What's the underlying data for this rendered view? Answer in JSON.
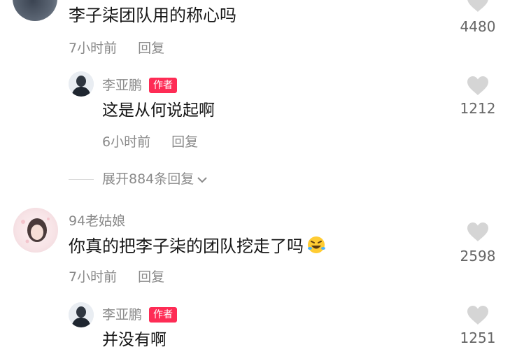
{
  "comments": [
    {
      "text": "李子柒团队用的称心吗",
      "time": "7小时前",
      "reply_label": "回复",
      "likes": "4480",
      "replies": [
        {
          "username": "李亚鹏",
          "badge": "作者",
          "text": "这是从何说起啊",
          "time": "6小时前",
          "reply_label": "回复",
          "likes": "1212"
        }
      ],
      "expand_label": "展开884条回复"
    },
    {
      "username": "94老姑娘",
      "text": "你真的把李子柒的团队挖走了吗",
      "emoji": "rolling-on-floor-laughing-emoji",
      "time": "7小时前",
      "reply_label": "回复",
      "likes": "2598",
      "replies": [
        {
          "username": "李亚鹏",
          "badge": "作者",
          "text": "并没有啊",
          "likes": "1251"
        }
      ]
    }
  ],
  "colors": {
    "badge": "#fe2c55",
    "heart": "#d5d5d5",
    "meta_text": "#8a8a8a"
  }
}
